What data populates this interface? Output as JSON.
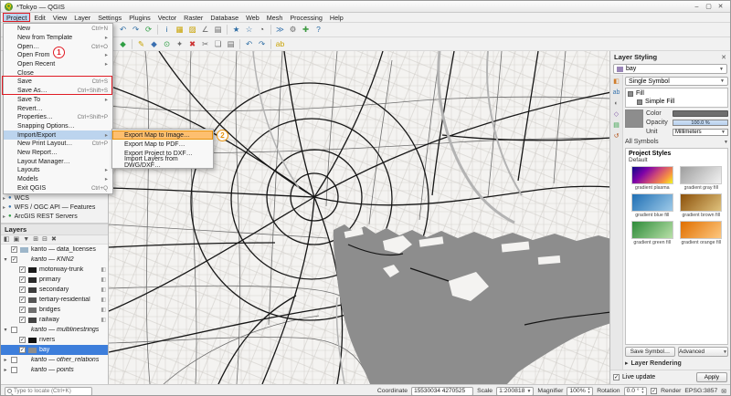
{
  "window": {
    "title": "*Tokyo — QGIS",
    "controls": [
      {
        "name": "minimize-button",
        "glyph": "–"
      },
      {
        "name": "maximize-button",
        "glyph": "▢"
      },
      {
        "name": "close-button",
        "glyph": "✕"
      }
    ]
  },
  "menubar": {
    "items": [
      {
        "label": "Project",
        "cls": "active"
      },
      {
        "label": "Edit"
      },
      {
        "label": "View"
      },
      {
        "label": "Layer"
      },
      {
        "label": "Settings"
      },
      {
        "label": "Plugins"
      },
      {
        "label": "Vector"
      },
      {
        "label": "Raster"
      },
      {
        "label": "Database"
      },
      {
        "label": "Web"
      },
      {
        "label": "Mesh"
      },
      {
        "label": "Processing"
      },
      {
        "label": "Help"
      }
    ]
  },
  "toolbars": {
    "row1": [
      {
        "name": "new-project-icon",
        "glyph": "▢",
        "c": "#5f5f5f"
      },
      {
        "name": "open-project-icon",
        "glyph": "▣",
        "c": "#c79236"
      },
      {
        "name": "save-project-icon",
        "glyph": "◆",
        "c": "#3a6fb0"
      },
      {
        "name": "separator",
        "cls": "sep"
      },
      {
        "name": "style-manager-icon",
        "glyph": "◧",
        "c": "#7a4fa3"
      },
      {
        "name": "separator",
        "cls": "sep"
      },
      {
        "name": "pan-map-icon",
        "glyph": "✛",
        "c": "#4a8f3c"
      },
      {
        "name": "zoom-in-icon",
        "glyph": "⊕",
        "c": "#2e6da4"
      },
      {
        "name": "zoom-out-icon",
        "glyph": "⊖",
        "c": "#2e6da4"
      },
      {
        "name": "zoom-full-icon",
        "glyph": "◎",
        "c": "#2e6da4"
      },
      {
        "name": "zoom-last-icon",
        "glyph": "↶",
        "c": "#2e6da4"
      },
      {
        "name": "zoom-next-icon",
        "glyph": "↷",
        "c": "#2e6da4"
      },
      {
        "name": "refresh-map-icon",
        "glyph": "⟳",
        "c": "#2f9e44"
      },
      {
        "name": "separator",
        "cls": "sep"
      },
      {
        "name": "identify-features-icon",
        "glyph": "i",
        "c": "#2e6da4"
      },
      {
        "name": "select-features-icon",
        "glyph": "▦",
        "c": "#c8a200"
      },
      {
        "name": "deselect-features-icon",
        "glyph": "▨",
        "c": "#c8a200"
      },
      {
        "name": "measure-icon",
        "glyph": "∠",
        "c": "#6b6b6b"
      },
      {
        "name": "attribute-table-icon",
        "glyph": "▤",
        "c": "#6b6b6b"
      },
      {
        "name": "separator",
        "cls": "sep"
      },
      {
        "name": "new-bookmark-icon",
        "glyph": "★",
        "c": "#2e6da4"
      },
      {
        "name": "show-bookmarks-icon",
        "glyph": "☆",
        "c": "#2e6da4"
      },
      {
        "name": "temporal-controller-icon",
        "glyph": "◔",
        "c": "#444444"
      },
      {
        "name": "separator",
        "cls": "sep"
      },
      {
        "name": "python-console-icon",
        "glyph": "≫",
        "c": "#3a76af"
      },
      {
        "name": "processing-toolbox-icon",
        "glyph": "⚙",
        "c": "#6b6b6b"
      },
      {
        "name": "plugins-icon",
        "glyph": "✚",
        "c": "#3f9b43"
      },
      {
        "name": "help-icon",
        "glyph": "?",
        "c": "#2e6da4"
      }
    ],
    "row2": [
      {
        "name": "data-source-manager-icon",
        "glyph": "◫",
        "c": "#8c6239"
      },
      {
        "name": "separator",
        "cls": "sep"
      },
      {
        "name": "add-vector-layer-icon",
        "glyph": "◇",
        "c": "#3f9b43"
      },
      {
        "name": "add-raster-layer-icon",
        "glyph": "▦",
        "c": "#666666"
      },
      {
        "name": "add-mesh-layer-icon",
        "glyph": "▲",
        "c": "#3a76af"
      },
      {
        "name": "add-delimited-text-icon",
        "glyph": "≔",
        "c": "#6b6b6b"
      },
      {
        "name": "add-postgis-icon",
        "glyph": "⊟",
        "c": "#33619e"
      },
      {
        "name": "add-wms-icon",
        "glyph": "◉",
        "c": "#2f9e44"
      },
      {
        "name": "separator",
        "cls": "sep"
      },
      {
        "name": "new-shapefile-icon",
        "glyph": "▭",
        "c": "#b07030"
      },
      {
        "name": "new-geopackage-icon",
        "glyph": "◆",
        "c": "#2f9e44"
      },
      {
        "name": "separator",
        "cls": "sep"
      },
      {
        "name": "toggle-editing-icon",
        "glyph": "✎",
        "c": "#c8a200"
      },
      {
        "name": "save-edits-icon",
        "glyph": "◆",
        "c": "#3a6fb0"
      },
      {
        "name": "add-feature-icon",
        "glyph": "⊙",
        "c": "#2f9e44"
      },
      {
        "name": "vertex-tool-icon",
        "glyph": "✦",
        "c": "#6b6b6b"
      },
      {
        "name": "delete-selected-icon",
        "glyph": "✖",
        "c": "#cc3333"
      },
      {
        "name": "cut-features-icon",
        "glyph": "✂",
        "c": "#6b6b6b"
      },
      {
        "name": "copy-features-icon",
        "glyph": "❏",
        "c": "#6b6b6b"
      },
      {
        "name": "paste-features-icon",
        "glyph": "▤",
        "c": "#6b6b6b"
      },
      {
        "name": "separator",
        "cls": "sep"
      },
      {
        "name": "undo-icon",
        "glyph": "↶",
        "c": "#2e6da4"
      },
      {
        "name": "redo-icon",
        "glyph": "↷",
        "c": "#2e6da4"
      },
      {
        "name": "separator",
        "cls": "sep"
      },
      {
        "name": "labels-icon",
        "glyph": "ab",
        "c": "#c8a200"
      }
    ]
  },
  "project_menu": {
    "items": [
      {
        "label": "New",
        "right": "Ctrl+N"
      },
      {
        "label": "New from Template",
        "right": "▸"
      },
      {
        "label": "Open…",
        "right": "Ctrl+O"
      },
      {
        "label": "Open From",
        "right": "▸"
      },
      {
        "label": "Open Recent",
        "right": "▸"
      },
      {
        "label": "Close",
        "right": ""
      },
      {
        "label": "Save",
        "right": "Ctrl+S"
      },
      {
        "label": "Save As…",
        "right": "Ctrl+Shift+S"
      },
      {
        "label": "Save To",
        "right": "▸"
      },
      {
        "label": "Revert…",
        "right": ""
      },
      {
        "label": "Properties…",
        "right": "Ctrl+Shift+P"
      },
      {
        "label": "Snapping Options…",
        "right": ""
      },
      {
        "label": "Import/Export",
        "right": "▸",
        "cls": "hl"
      },
      {
        "label": "New Print Layout…",
        "right": "Ctrl+P"
      },
      {
        "label": "New Report…",
        "right": ""
      },
      {
        "label": "Layout Manager…",
        "right": ""
      },
      {
        "label": "Layouts",
        "right": "▸"
      },
      {
        "label": "Models",
        "right": "▸"
      },
      {
        "label": "Exit QGIS",
        "right": "Ctrl+Q"
      }
    ]
  },
  "import_export_menu": {
    "items": [
      {
        "label": "Export Map to Image…",
        "cls": "hl-or"
      },
      {
        "label": "Export Map to PDF…"
      },
      {
        "label": "Export Project to DXF…"
      },
      {
        "label": "Import Layers from DWG/DXF…"
      }
    ]
  },
  "annotations": {
    "step1": "1",
    "step2": "2"
  },
  "browser_panel": {
    "items": [
      {
        "label": "WCS",
        "c": "#3a76af"
      },
      {
        "label": "WFS / OGC API — Features",
        "c": "#3a76af"
      },
      {
        "label": "ArcGIS REST Servers",
        "c": "#2f9e44"
      }
    ]
  },
  "layers_panel": {
    "title": "Layers",
    "tools": [
      {
        "name": "open-layer-styling-icon",
        "glyph": "◧"
      },
      {
        "name": "add-group-icon",
        "glyph": "▣"
      },
      {
        "name": "filter-legend-icon",
        "glyph": "▼"
      },
      {
        "name": "expand-all-icon",
        "glyph": "⊞"
      },
      {
        "name": "collapse-all-icon",
        "glyph": "⊟"
      },
      {
        "name": "remove-layer-icon",
        "glyph": "✖"
      }
    ],
    "items": [
      {
        "label": "kanto — data_licenses",
        "check": "✓",
        "arrow": "",
        "cls": "",
        "sw": "#9db6c9"
      },
      {
        "label": "kanto — KNN2",
        "check": "✓",
        "arrow": "▾",
        "cls": "grp",
        "sw": ""
      },
      {
        "label": "motorway-trunk",
        "check": "✓",
        "arrow": "",
        "cls": "ind",
        "sw": "#1a1a1a",
        "badge": "◧"
      },
      {
        "label": "primary",
        "check": "✓",
        "arrow": "",
        "cls": "ind",
        "sw": "#2b2b2b",
        "badge": "◧"
      },
      {
        "label": "secondary",
        "check": "✓",
        "arrow": "",
        "cls": "ind",
        "sw": "#3c3c3c",
        "badge": "◧"
      },
      {
        "label": "tertiary-residential",
        "check": "✓",
        "arrow": "",
        "cls": "ind",
        "sw": "#555555",
        "badge": "◧"
      },
      {
        "label": "bridges",
        "check": "✓",
        "arrow": "",
        "cls": "ind",
        "sw": "#6f6f6f",
        "badge": "◧"
      },
      {
        "label": "railway",
        "check": "✓",
        "arrow": "",
        "cls": "ind",
        "sw": "#444444",
        "badge": "◧"
      },
      {
        "label": "kanto — multilinestrings",
        "check": "",
        "arrow": "▾",
        "cls": "grp",
        "sw": ""
      },
      {
        "label": "rivers",
        "check": "✓",
        "arrow": "",
        "cls": "ind",
        "sw": "#111111"
      },
      {
        "label": "bay",
        "check": "✓",
        "arrow": "",
        "cls": "ind sel",
        "sw": "#8d8d8d"
      },
      {
        "label": "kanto — other_relations",
        "check": "",
        "arrow": "▸",
        "cls": "grp",
        "sw": ""
      },
      {
        "label": "kanto — points",
        "check": "",
        "arrow": "▸",
        "cls": "grp",
        "sw": ""
      }
    ]
  },
  "styling_panel": {
    "title": "Layer Styling",
    "close_glyph": "✕",
    "layer_combo": "bay",
    "tabs": [
      {
        "name": "symbology-tab-icon",
        "glyph": "◧",
        "c": "#d07d2c"
      },
      {
        "name": "labels-tab-icon",
        "glyph": "ab",
        "c": "#3a76af"
      },
      {
        "name": "masks-tab-icon",
        "glyph": "◐",
        "c": "#666666"
      },
      {
        "name": "3d-view-tab-icon",
        "glyph": "◇",
        "c": "#7a4fa3"
      },
      {
        "name": "diagrams-tab-icon",
        "glyph": "▤",
        "c": "#2f9e44"
      },
      {
        "name": "history-tab-icon",
        "glyph": "↺",
        "c": "#b3541e"
      }
    ],
    "symbol_type": "Single Symbol",
    "tree_fill": "Fill",
    "tree_simple_fill": "Simple Fill",
    "color_label": "Color",
    "opacity_label": "Opacity",
    "opacity_value": "100.0 %",
    "unit_label": "Unit",
    "unit_value": "Millimeters",
    "symbols_filter": "All Symbols",
    "project_styles": "Project Styles",
    "default_group": "Default",
    "gradients": [
      {
        "label": "gradient plasma",
        "grad": "linear-gradient(135deg,#0d0887 0%,#7e03a8 30%,#cc4778 55%,#f89441 80%,#f0f921 100%)"
      },
      {
        "label": "gradient gray fill",
        "grad": "linear-gradient(135deg,#9e9e9e,#f2f2f2)"
      },
      {
        "label": "gradient blue fill",
        "grad": "linear-gradient(135deg,#1f6fb4,#9ecae8)"
      },
      {
        "label": "gradient brown fill",
        "grad": "linear-gradient(135deg,#8c510a,#dfc27d)"
      },
      {
        "label": "gradient green fill",
        "grad": "linear-gradient(135deg,#2e8b3a,#b8e0a8)"
      },
      {
        "label": "gradient orange fill",
        "grad": "linear-gradient(135deg,#e06f00,#fdc77f)"
      }
    ],
    "save_symbol": "Save Symbol…",
    "advanced": "Advanced",
    "layer_rendering": "Layer Rendering",
    "live_update": "Live update",
    "apply": "Apply"
  },
  "statusbar": {
    "locator_placeholder": "Type to locate (Ctrl+K)",
    "coordinate_label": "Coordinate",
    "coordinate_value": "15530034 4270525",
    "scale_label": "Scale",
    "scale_value": "1:200818",
    "magnifier_label": "Magnifier",
    "magnifier_value": "100%",
    "rotation_label": "Rotation",
    "rotation_value": "0.0 °",
    "render_label": "Render",
    "crs": "EPSG:3857",
    "messages_glyph": "✉"
  }
}
